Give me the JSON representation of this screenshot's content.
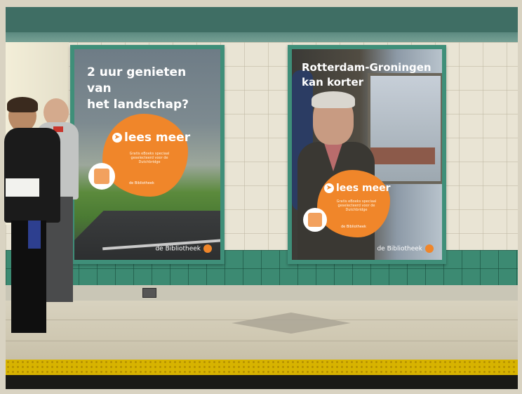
{
  "poster_left": {
    "headline_line1": "2 uur genieten van",
    "headline_line2": "het landschap?",
    "cta": "lees meer",
    "cta_subtext": "Gratis eBoeks speciaal geselecteerd voor de Dutchbridge",
    "blob_mini": "de Bibliotheek",
    "brand": "de Bibliotheek"
  },
  "poster_right": {
    "headline_line1": "Rotterdam-Groningen",
    "headline_line2": "kan korter",
    "cta": "lees meer",
    "cta_subtext": "Gratis eBoeks speciaal geselecteerd voor de Dutchbridge",
    "blob_mini": "de Bibliotheek",
    "brand": "de Bibliotheek"
  },
  "colors": {
    "accent_orange": "#f0862a",
    "frame_green": "#3f8f79",
    "tile_green": "#3c8a72",
    "safety_yellow": "#d7b300"
  },
  "icons": {
    "cta_arrow": "arrow-right-icon",
    "library_logo": "bibliotheek-logo-icon"
  }
}
